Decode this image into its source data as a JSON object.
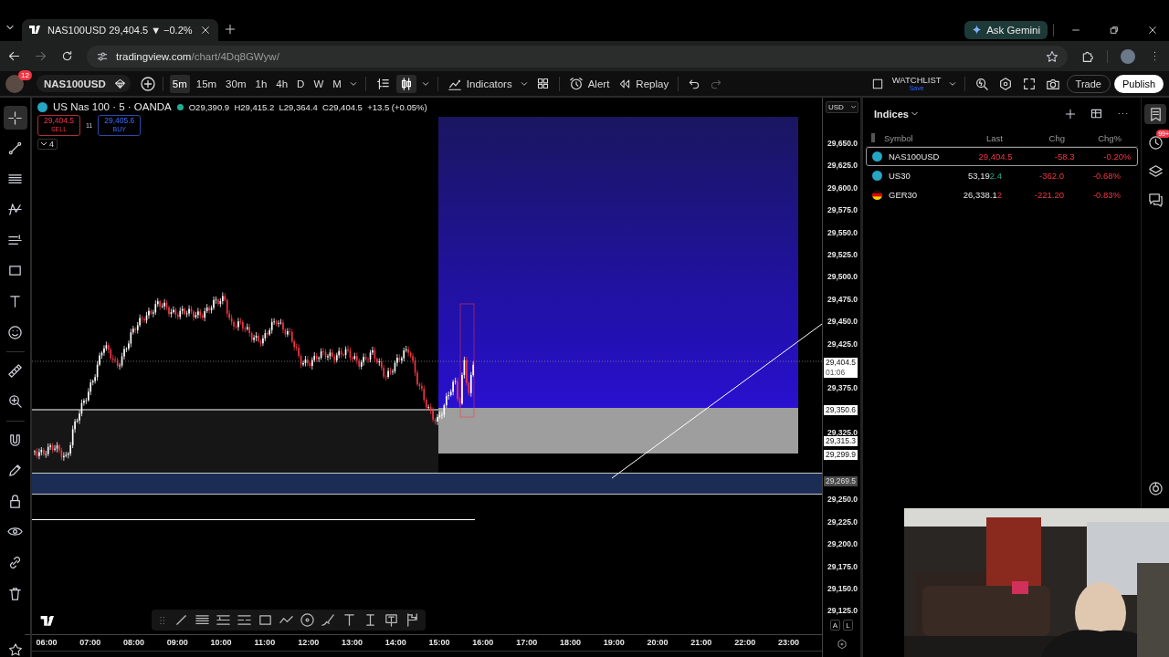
{
  "browser": {
    "tab_title": "NAS100USD 29,404.5 ▼ −0.2%",
    "gemini_button": "Ask Gemini",
    "url_host": "tradingview.com",
    "url_path": "/chart/4Dq8GWyw/",
    "forward_disabled": true
  },
  "toolbar": {
    "notification_count": "12",
    "symbol": "NAS100USD",
    "intervals": [
      {
        "label": "5m",
        "selected": true
      },
      {
        "label": "15m",
        "selected": false
      },
      {
        "label": "30m",
        "selected": false
      },
      {
        "label": "1h",
        "selected": false
      },
      {
        "label": "4h",
        "selected": false
      },
      {
        "label": "D",
        "selected": false
      },
      {
        "label": "W",
        "selected": false
      },
      {
        "label": "M",
        "selected": false
      }
    ],
    "chart_styles": [
      {
        "selected": false
      },
      {
        "selected": true
      }
    ],
    "indicators": "Indicators",
    "alert": "Alert",
    "replay": "Replay",
    "redo_disabled": true,
    "watchlist_title": "WATCHLIST",
    "watchlist_action": "Save",
    "trade": "Trade",
    "publish": "Publish"
  },
  "tools": [
    {
      "selected": true
    },
    {
      "selected": false
    },
    {
      "selected": false
    },
    {
      "selected": false
    },
    {
      "selected": false
    },
    {
      "selected": false
    },
    {
      "selected": false
    },
    {
      "selected": false
    },
    {
      "selected": false
    },
    {
      "selected": false
    },
    {
      "selected": false
    },
    {
      "selected": false
    },
    {
      "selected": false
    },
    {
      "selected": false
    },
    {
      "selected": false
    },
    {
      "selected": false
    }
  ],
  "legend": {
    "title": "US Nas 100 · 5 · OANDA",
    "market_open": true,
    "ohlc": "O29,390.9  H29,415.2  L29,364.4  C29,404.5  +13.5 (+0.05%)",
    "sell_price": "29,404.5",
    "sell_label": "SELL",
    "spread": "11",
    "buy_price": "29,405.6",
    "buy_label": "BUY",
    "indicator_count": "4"
  },
  "price_axis": {
    "currency": "USD",
    "labels": [
      "29,650.0",
      "29,625.0",
      "29,600.0",
      "29,575.0",
      "29,550.0",
      "29,525.0",
      "29,500.0",
      "29,475.0",
      "29,450.0",
      "29,425.0",
      "29,375.0",
      "29,325.0",
      "29,250.0",
      "29,225.0",
      "29,200.0",
      "29,175.0",
      "29,150.0",
      "29,125.0"
    ],
    "tags": [
      {
        "kind": "last",
        "price": "29,404.5",
        "countdown": "01:06"
      },
      {
        "kind": "level",
        "price": "29,350.6"
      },
      {
        "kind": "level",
        "price": "29,315.3"
      },
      {
        "kind": "level",
        "price": "29,299.9"
      },
      {
        "kind": "band",
        "price": "29,269.5"
      }
    ],
    "scale_buttons": [
      "A",
      "L"
    ]
  },
  "time_axis": [
    "06:00",
    "07:00",
    "08:00",
    "09:00",
    "10:00",
    "11:00",
    "12:00",
    "13:00",
    "14:00",
    "15:00",
    "16:00",
    "17:00",
    "18:00",
    "19:00",
    "20:00",
    "21:00",
    "22:00",
    "23:00"
  ],
  "watchlist": {
    "title": "Indices",
    "columns": [
      "Symbol",
      "Last",
      "Chg",
      "Chg%"
    ],
    "rows": [
      {
        "symbol": "NAS100USD",
        "kind": "badge",
        "selected": true,
        "last_tail": "29,404.5",
        "tick_up": false,
        "chg": "-58.3",
        "chg_pct": "-0.20%",
        "negative": true
      },
      {
        "symbol": "US30",
        "kind": "badge",
        "selected": false,
        "last_head": "53,19",
        "last_tail": "2.4",
        "tick_up": true,
        "chg": "-362.0",
        "chg_pct": "-0.68%",
        "negative": true
      },
      {
        "symbol": "GER30",
        "kind": "flag",
        "selected": false,
        "last_head": "26,338.1",
        "last_tail": "2",
        "tick_up": false,
        "chg": "-221.20",
        "chg_pct": "-0.83%",
        "negative": true
      }
    ]
  },
  "right_rail": {
    "alerts_badge": "99+",
    "watchlist_selected": true
  }
}
